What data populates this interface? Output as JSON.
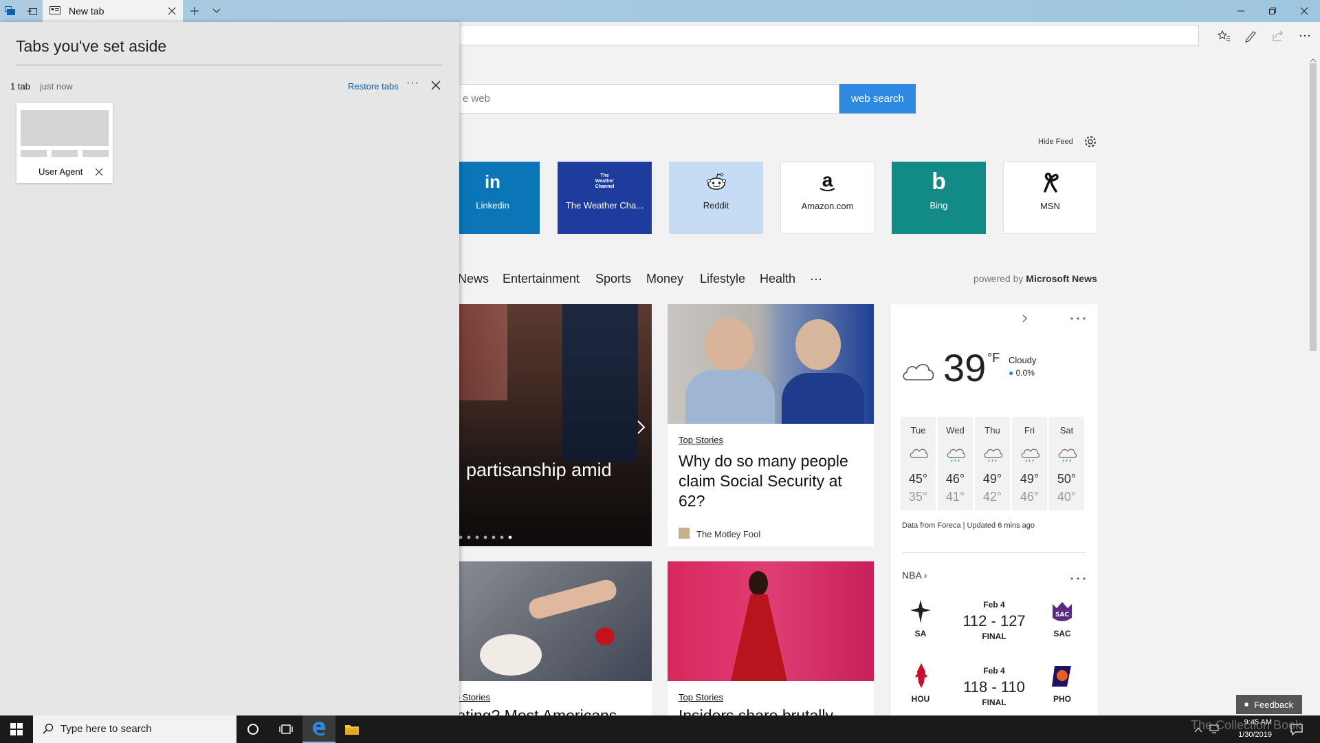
{
  "tab": {
    "title": "New tab"
  },
  "search": {
    "placeholder": "e web",
    "button_label": "web search"
  },
  "feed": {
    "hide_label": "Hide Feed"
  },
  "tiles": [
    {
      "label": "Linkedin",
      "icon": "linkedin-icon",
      "bg": "#0a76b7",
      "fg": "#ffffff"
    },
    {
      "label": "The Weather Cha...",
      "icon": "weather-channel-icon",
      "bg": "#1d3c9e",
      "fg": "#ffffff"
    },
    {
      "label": "Reddit",
      "icon": "reddit-icon",
      "bg": "#c6dcf5",
      "fg": "#222222"
    },
    {
      "label": "Amazon.com",
      "icon": "amazon-icon",
      "bg": "#ffffff",
      "fg": "#222222"
    },
    {
      "label": "Bing",
      "icon": "bing-icon",
      "bg": "#128a86",
      "fg": "#ffffff"
    },
    {
      "label": "MSN",
      "icon": "msn-icon",
      "bg": "#ffffff",
      "fg": "#222222"
    }
  ],
  "tile_icon_text": {
    "linkedin": "in",
    "weather_line1": "The",
    "weather_line2": "Weather",
    "weather_line3": "Channel",
    "amazon": "a",
    "bing": "b"
  },
  "news_nav": {
    "items": [
      "News",
      "Entertainment",
      "Sports",
      "Money",
      "Lifestyle",
      "Health",
      "···"
    ],
    "powered_prefix": "powered by",
    "powered_brand": "Microsoft News"
  },
  "cards": {
    "main": {
      "headline": "partisanship amid"
    },
    "top_story": {
      "category": "Top Stories",
      "headline": "Why do so many people claim Social Security at 62?",
      "source": "The Motley Fool"
    },
    "dating": {
      "category": "Top Stories",
      "headline": "Dating? Most Americans"
    },
    "insiders": {
      "category": "Top Stories",
      "headline": "Insiders share brutally"
    }
  },
  "weather": {
    "temp": "39",
    "unit": "°F",
    "condition": "Cloudy",
    "precip": "0.0%",
    "forecast": [
      {
        "day": "Tue",
        "hi": "45°",
        "lo": "35°",
        "icon": "cloudy-icon"
      },
      {
        "day": "Wed",
        "hi": "46°",
        "lo": "41°",
        "icon": "rain-icon"
      },
      {
        "day": "Thu",
        "hi": "49°",
        "lo": "42°",
        "icon": "rain-icon"
      },
      {
        "day": "Fri",
        "hi": "49°",
        "lo": "46°",
        "icon": "rain-icon"
      },
      {
        "day": "Sat",
        "hi": "50°",
        "lo": "40°",
        "icon": "rain-icon"
      }
    ],
    "source": "Data from Foreca | Updated 6 mins ago"
  },
  "nba": {
    "title": "NBA",
    "games": [
      {
        "date": "Feb 4",
        "score": "112 - 127",
        "status": "FINAL",
        "home": "SA",
        "away": "SAC"
      },
      {
        "date": "Feb 4",
        "score": "118 - 110",
        "status": "FINAL",
        "home": "HOU",
        "away": "PHO"
      }
    ]
  },
  "aside_panel": {
    "title": "Tabs you've set aside",
    "count": "1 tab",
    "time": "just now",
    "restore_label": "Restore tabs",
    "more_label": "···",
    "thumb_title": "User Agent"
  },
  "feedback": {
    "label": "Feedback"
  },
  "taskbar": {
    "search_placeholder": "Type here to search",
    "time": "9:45 AM",
    "date": "1/30/2019"
  },
  "watermark": "The Collection Book"
}
